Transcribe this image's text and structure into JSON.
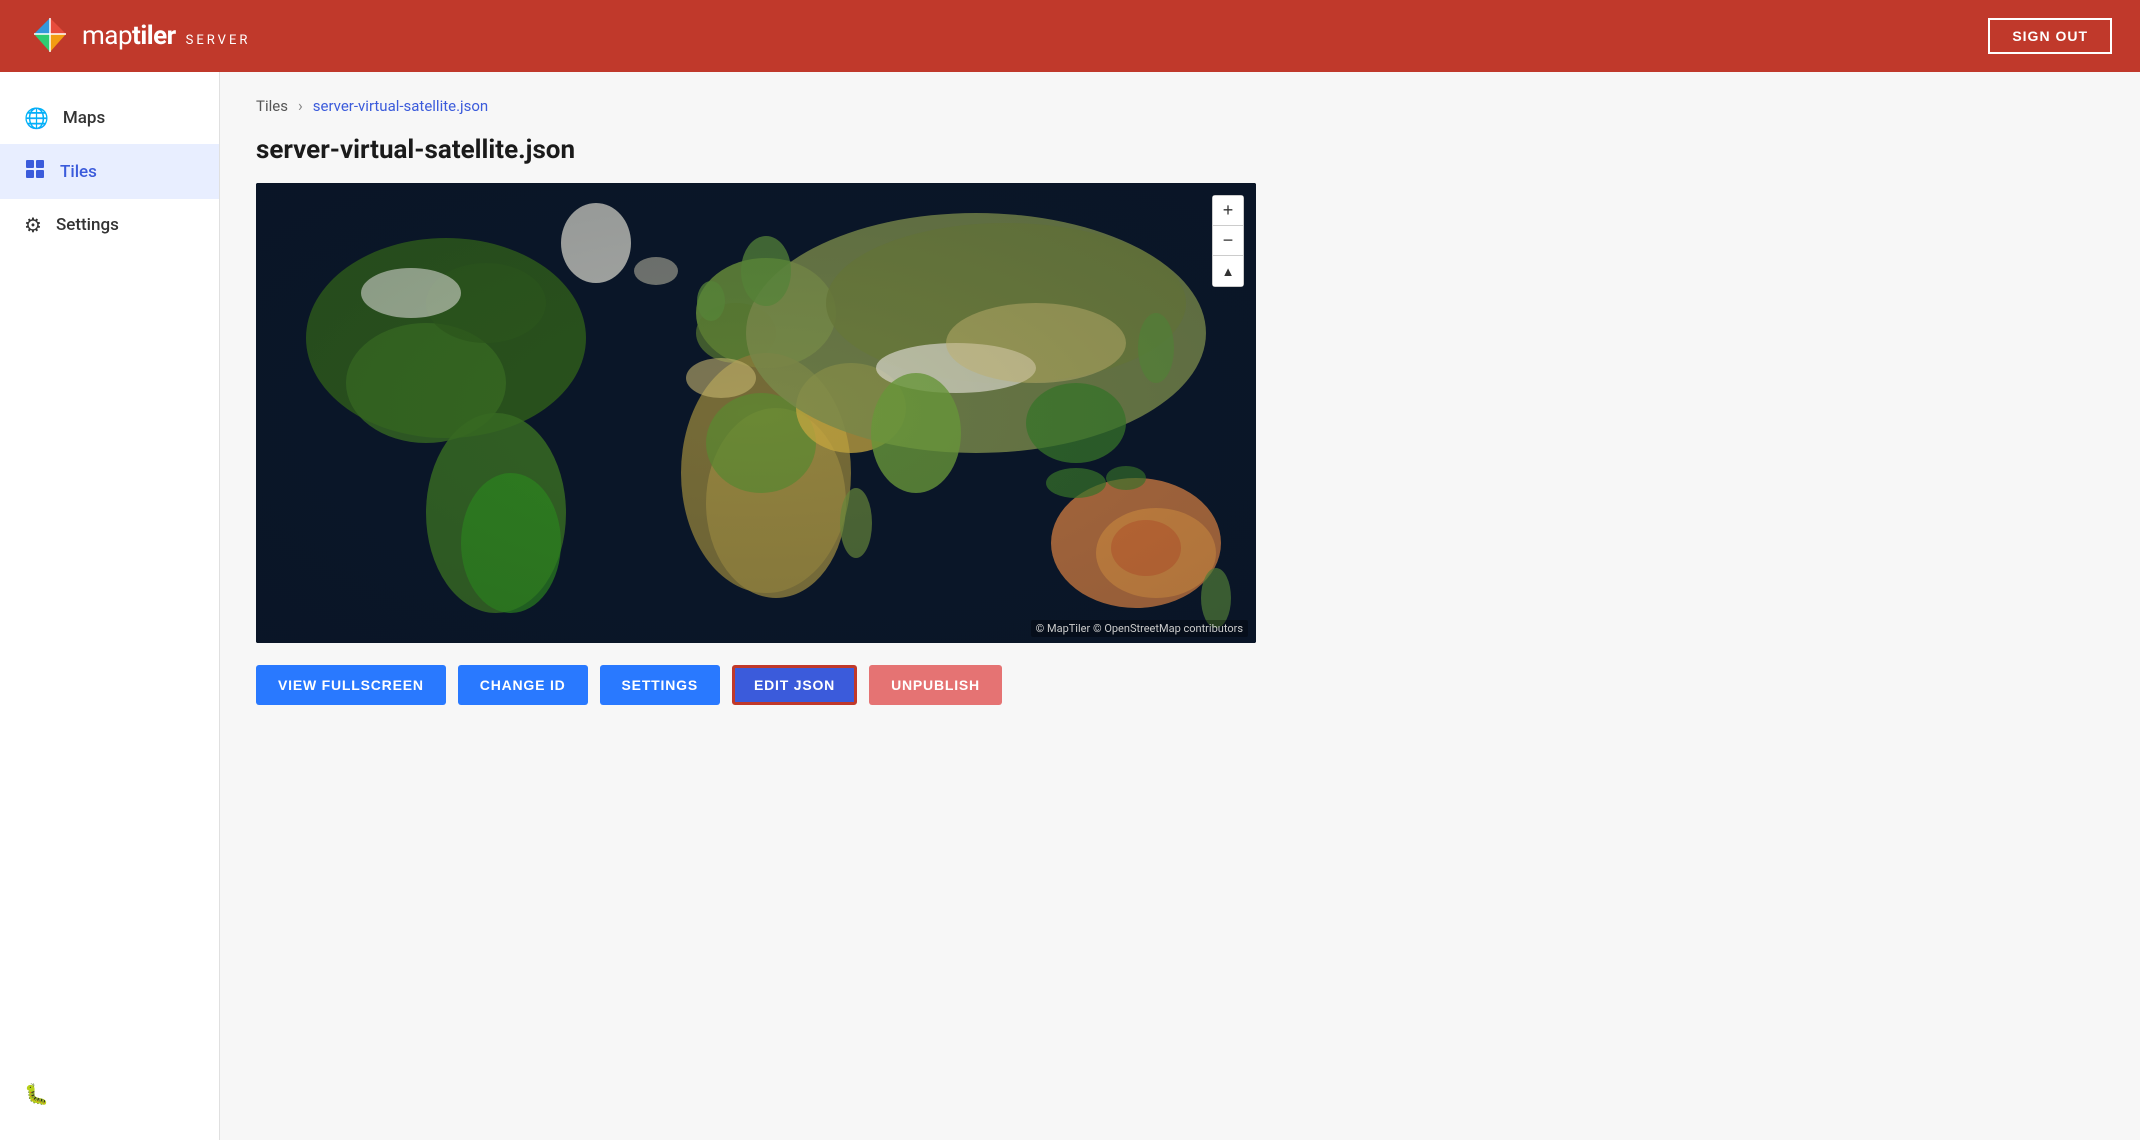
{
  "header": {
    "logo_map": "map",
    "logo_tiler": "tiler",
    "logo_server": "SERVER",
    "sign_out_label": "SIGN OUT"
  },
  "sidebar": {
    "items": [
      {
        "id": "maps",
        "label": "Maps",
        "icon": "🌐",
        "active": false
      },
      {
        "id": "tiles",
        "label": "Tiles",
        "icon": "◈",
        "active": true
      },
      {
        "id": "settings",
        "label": "Settings",
        "icon": "⚙",
        "active": false
      }
    ],
    "bottom_item": {
      "label": "🐛",
      "id": "debug"
    }
  },
  "breadcrumb": {
    "parent_label": "Tiles",
    "separator": "›",
    "current_label": "server-virtual-satellite.json"
  },
  "page": {
    "title": "server-virtual-satellite.json"
  },
  "map": {
    "attribution": "© MapTiler © OpenStreetMap contributors",
    "zoom_in_label": "+",
    "zoom_out_label": "−",
    "compass_label": "▲"
  },
  "actions": {
    "view_fullscreen_label": "VIEW FULLSCREEN",
    "change_id_label": "CHANGE ID",
    "settings_label": "SETTINGS",
    "edit_json_label": "EDIT JSON",
    "unpublish_label": "UNPUBLISH"
  }
}
